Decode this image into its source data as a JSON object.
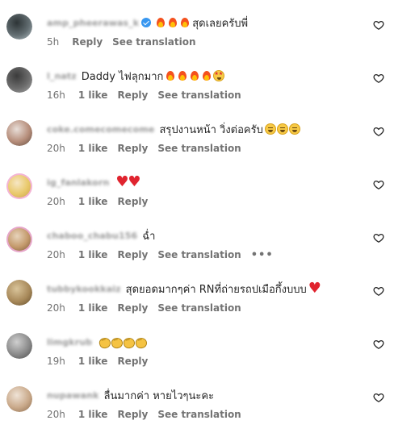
{
  "comments": [
    {
      "username": "amp_pheerawas_k",
      "verified": true,
      "text": "สุดเลยครับพี่",
      "emoji_before": [
        "fire",
        "fire",
        "fire"
      ],
      "emoji_after": [],
      "time": "5h",
      "likes": "",
      "reply_label": "Reply",
      "translate_label": "See translation",
      "more": false,
      "avatar_colors": [
        "#2d3436",
        "#636e72",
        "#b2bec3"
      ]
    },
    {
      "username": "l_natz",
      "verified": false,
      "text": "Daddy ไฟลุกมาก",
      "emoji_before": [],
      "emoji_after": [
        "fire",
        "fire",
        "fire",
        "fire",
        "starstruck"
      ],
      "time": "16h",
      "likes": "1 like",
      "reply_label": "Reply",
      "translate_label": "See translation",
      "more": false,
      "avatar_colors": [
        "#3b3b3b",
        "#6d6d6d",
        "#a8a8a8"
      ]
    },
    {
      "username": "coke.comecomecome",
      "verified": false,
      "text": "สรุปงานหน้า วิ่งต่อครับ",
      "emoji_before": [],
      "emoji_after": [
        "laugh",
        "laugh",
        "laugh"
      ],
      "time": "20h",
      "likes": "1 like",
      "reply_label": "Reply",
      "translate_label": "See translation",
      "more": false,
      "avatar_colors": [
        "#e8ded8",
        "#b68d7a",
        "#5d4a3f"
      ]
    },
    {
      "username": "ig_fanlakorn",
      "verified": false,
      "text": "",
      "emoji_before": [],
      "emoji_after": [
        "heart",
        "heart"
      ],
      "time": "20h",
      "likes": "1 like",
      "reply_label": "Reply",
      "translate_label": "",
      "more": false,
      "avatar_colors": [
        "#f6e6c4",
        "#e9c96b",
        "#c9a24a"
      ],
      "ring_color": "#f3b4d4"
    },
    {
      "username": "chaboo_chabu156",
      "verified": false,
      "text": "ฉ่ำ",
      "emoji_before": [],
      "emoji_after": [],
      "time": "20h",
      "likes": "1 like",
      "reply_label": "Reply",
      "translate_label": "See translation",
      "more": true,
      "more_label": "•••",
      "avatar_colors": [
        "#e7d3bb",
        "#c49a6c",
        "#7d5a3c"
      ],
      "ring_color": "#e6a6c9"
    },
    {
      "username": "tubbykookkaiz",
      "verified": false,
      "text": "สุดยอดมากๆค่า RNที่ถ่ายรถปเมือกึ้งบบบ",
      "emoji_before": [],
      "emoji_after": [
        "heart"
      ],
      "time": "20h",
      "likes": "1 like",
      "reply_label": "Reply",
      "translate_label": "See translation",
      "more": false,
      "avatar_colors": [
        "#d9c49a",
        "#a8895a",
        "#5f4a2a"
      ]
    },
    {
      "username": "limgkrub",
      "verified": false,
      "text": "",
      "emoji_before": [],
      "emoji_after": [
        "clap",
        "clap",
        "clap",
        "clap"
      ],
      "time": "19h",
      "likes": "1 like",
      "reply_label": "Reply",
      "translate_label": "",
      "more": false,
      "avatar_colors": [
        "#cfcfcf",
        "#8a8a8a",
        "#4a4a4a"
      ]
    },
    {
      "username": "nupawank",
      "verified": false,
      "text": "ลื่นมากค่า หายไวๆนะคะ",
      "emoji_before": [],
      "emoji_after": [],
      "time": "20h",
      "likes": "1 like",
      "reply_label": "Reply",
      "translate_label": "See translation",
      "more": false,
      "avatar_colors": [
        "#efe3d6",
        "#c9a98a",
        "#8a6a4c"
      ]
    }
  ],
  "icons": {
    "like": "heart-outline-icon",
    "verified": "verified-badge-icon",
    "more": "more-horizontal-icon"
  }
}
